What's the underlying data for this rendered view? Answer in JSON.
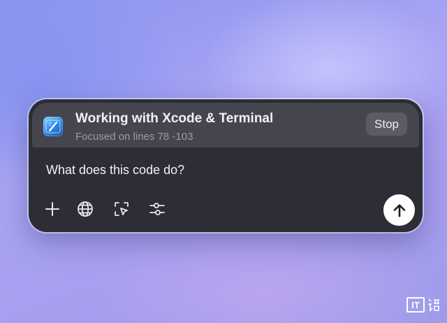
{
  "header": {
    "app_icon": "xcode-icon",
    "title": "Working with Xcode & Terminal",
    "subtitle": "Focused on lines 78 -103",
    "stop_label": "Stop"
  },
  "prompt": {
    "text": "What does this code do?"
  },
  "toolbar": {
    "tools": [
      "plus-icon",
      "globe-icon",
      "select-area-icon",
      "sliders-icon"
    ],
    "send_icon": "arrow-up-icon"
  },
  "watermark": {
    "mark": "IT",
    "icon": "ithome-logo"
  },
  "colors": {
    "panel": "#2d2d36",
    "header": "#45454f",
    "stop_button": "#5b5b65",
    "send_button": "#ffffff"
  }
}
